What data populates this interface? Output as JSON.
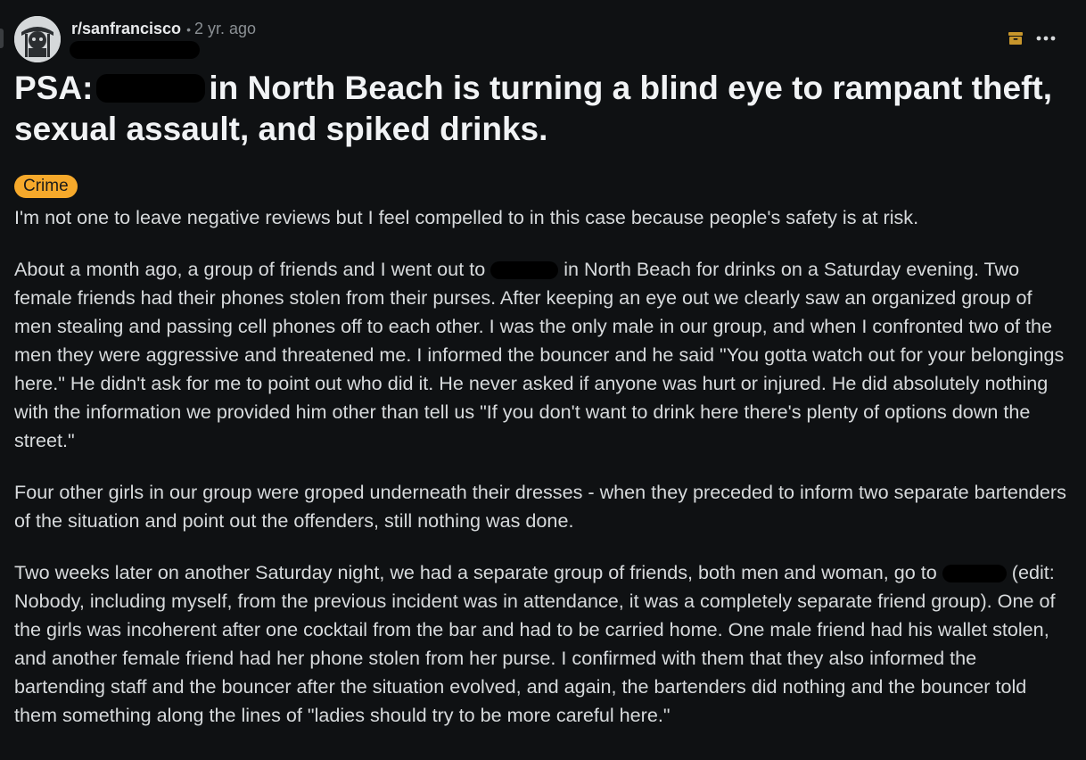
{
  "header": {
    "subreddit": "r/sanfrancisco",
    "separator": "•",
    "age": "2 yr. ago"
  },
  "icons": {
    "archive": "archive-icon",
    "more": "more-options-icon",
    "accent": "#c7962c"
  },
  "post": {
    "title_prefix": "PSA:",
    "title_rest": "in North Beach is turning a blind eye to rampant theft, sexual assault, and spiked drinks.",
    "flair": "Crime",
    "flair_color": "#f6a92b",
    "p1": "I'm not one to leave negative reviews but I feel compelled to in this case because people's safety is at risk.",
    "p2_a": "About a month ago, a group of friends and I went out to",
    "p2_b": "in North Beach for drinks on a Saturday evening. Two female friends had their phones stolen from their purses. After keeping an eye out we clearly saw an organized group of men stealing and passing cell phones off to each other. I was the only male in our group, and when I confronted two of the men they were aggressive and threatened me. I informed the bouncer and he said \"You gotta watch out for your belongings here.\" He didn't ask for me to point out who did it. He never asked if anyone was hurt or injured. He did absolutely nothing with the information we provided him other than tell us \"If you don't want to drink here there's plenty of options down the street.\"",
    "p3": "Four other girls in our group were groped underneath their dresses - when they preceded to inform two separate bartenders of the situation and point out the offenders, still nothing was done.",
    "p4_a": "Two weeks later on another Saturday night, we had a separate group of friends, both men and woman, go to",
    "p4_b": "(edit: Nobody, including myself, from the previous incident was in attendance, it was a completely separate friend group). One of the girls was incoherent after one cocktail from the bar and had to be carried home. One male friend had his wallet stolen, and another female friend had her phone stolen from her purse. I confirmed with them that they also informed the bartending staff and the bouncer after the situation evolved, and again, the bartenders did nothing and the bouncer told them something along the lines of \"ladies should try to be more careful here.\""
  }
}
